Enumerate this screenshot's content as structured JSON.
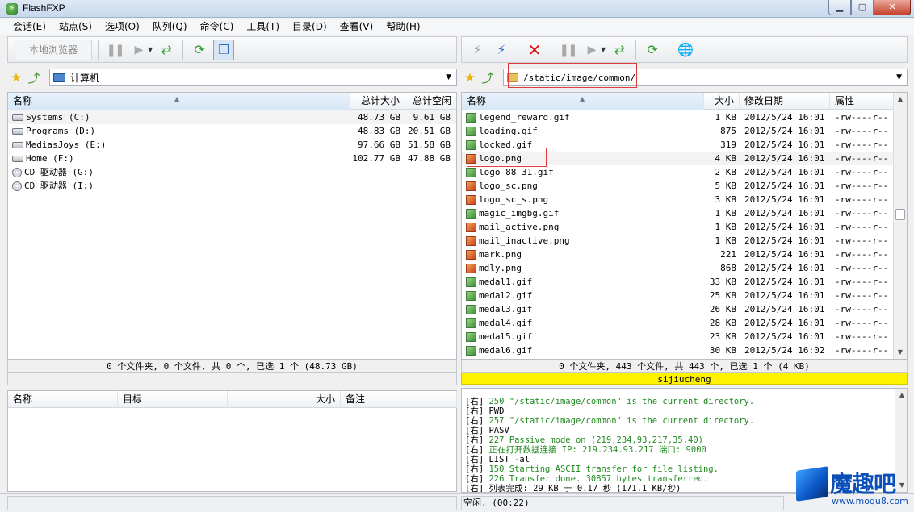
{
  "window": {
    "title": "FlashFXP",
    "icon": "flashfxp-app-icon"
  },
  "menu": [
    "会话(E)",
    "站点(S)",
    "选项(O)",
    "队列(Q)",
    "命令(C)",
    "工具(T)",
    "目录(D)",
    "查看(V)",
    "帮助(H)"
  ],
  "toolbar_left": {
    "browse_label": "本地浏览器"
  },
  "local": {
    "address": "计算机",
    "columns": {
      "name": "名称",
      "total": "总计大小",
      "free": "总计空闲"
    },
    "rows": [
      {
        "name": "Systems (C:)",
        "total": "48.73 GB",
        "free": "9.61 GB",
        "icon": "drive"
      },
      {
        "name": "Programs (D:)",
        "total": "48.83 GB",
        "free": "20.51 GB",
        "icon": "drive"
      },
      {
        "name": "MediasJoys (E:)",
        "total": "97.66 GB",
        "free": "51.58 GB",
        "icon": "drive"
      },
      {
        "name": "Home (F:)",
        "total": "102.77 GB",
        "free": "47.88 GB",
        "icon": "drive"
      },
      {
        "name": "CD 驱动器 (G:)",
        "total": "",
        "free": "",
        "icon": "cd"
      },
      {
        "name": "CD 驱动器 (I:)",
        "total": "",
        "free": "",
        "icon": "cd"
      }
    ],
    "status": "0 个文件夹, 0 个文件, 共 0 个, 已选 1 个 (48.73 GB)"
  },
  "remote": {
    "address": "/static/image/common/",
    "columns": {
      "name": "名称",
      "size": "大小",
      "date": "修改日期",
      "attr": "属性"
    },
    "rows": [
      {
        "name": "legend_reward.gif",
        "size": "1 KB",
        "date": "2012/5/24 16:01",
        "attr": "-rw----r--",
        "icon": "gif"
      },
      {
        "name": "loading.gif",
        "size": "875",
        "date": "2012/5/24 16:01",
        "attr": "-rw----r--",
        "icon": "gif"
      },
      {
        "name": "locked.gif",
        "size": "319",
        "date": "2012/5/24 16:01",
        "attr": "-rw----r--",
        "icon": "gif"
      },
      {
        "name": "logo.png",
        "size": "4 KB",
        "date": "2012/5/24 16:01",
        "attr": "-rw----r--",
        "icon": "png"
      },
      {
        "name": "logo_88_31.gif",
        "size": "2 KB",
        "date": "2012/5/24 16:01",
        "attr": "-rw----r--",
        "icon": "gif"
      },
      {
        "name": "logo_sc.png",
        "size": "5 KB",
        "date": "2012/5/24 16:01",
        "attr": "-rw----r--",
        "icon": "png"
      },
      {
        "name": "logo_sc_s.png",
        "size": "3 KB",
        "date": "2012/5/24 16:01",
        "attr": "-rw----r--",
        "icon": "png"
      },
      {
        "name": "magic_imgbg.gif",
        "size": "1 KB",
        "date": "2012/5/24 16:01",
        "attr": "-rw----r--",
        "icon": "gif"
      },
      {
        "name": "mail_active.png",
        "size": "1 KB",
        "date": "2012/5/24 16:01",
        "attr": "-rw----r--",
        "icon": "png"
      },
      {
        "name": "mail_inactive.png",
        "size": "1 KB",
        "date": "2012/5/24 16:01",
        "attr": "-rw----r--",
        "icon": "png"
      },
      {
        "name": "mark.png",
        "size": "221",
        "date": "2012/5/24 16:01",
        "attr": "-rw----r--",
        "icon": "png"
      },
      {
        "name": "mdly.png",
        "size": "868",
        "date": "2012/5/24 16:01",
        "attr": "-rw----r--",
        "icon": "png"
      },
      {
        "name": "medal1.gif",
        "size": "33 KB",
        "date": "2012/5/24 16:01",
        "attr": "-rw----r--",
        "icon": "gif"
      },
      {
        "name": "medal2.gif",
        "size": "25 KB",
        "date": "2012/5/24 16:01",
        "attr": "-rw----r--",
        "icon": "gif"
      },
      {
        "name": "medal3.gif",
        "size": "26 KB",
        "date": "2012/5/24 16:01",
        "attr": "-rw----r--",
        "icon": "gif"
      },
      {
        "name": "medal4.gif",
        "size": "28 KB",
        "date": "2012/5/24 16:01",
        "attr": "-rw----r--",
        "icon": "gif"
      },
      {
        "name": "medal5.gif",
        "size": "23 KB",
        "date": "2012/5/24 16:01",
        "attr": "-rw----r--",
        "icon": "gif"
      },
      {
        "name": "medal6.gif",
        "size": "30 KB",
        "date": "2012/5/24 16:02",
        "attr": "-rw----r--",
        "icon": "gif"
      }
    ],
    "status": "0 个文件夹, 443 个文件, 共 443 个, 已选 1 个 (4 KB)",
    "user": "sijiucheng"
  },
  "queue": {
    "columns": {
      "name": "名称",
      "target": "目标",
      "size": "大小",
      "note": "备注"
    }
  },
  "log": [
    {
      "tag": "[右]",
      "msg": "250 \"/static/image/common\" is the current directory.",
      "color": "green"
    },
    {
      "tag": "[右]",
      "msg": "PWD",
      "color": "black"
    },
    {
      "tag": "[右]",
      "msg": "257 \"/static/image/common\" is the current directory.",
      "color": "green"
    },
    {
      "tag": "[右]",
      "msg": "PASV",
      "color": "black"
    },
    {
      "tag": "[右]",
      "msg": "227 Passive mode on (219,234,93,217,35,40)",
      "color": "green"
    },
    {
      "tag": "[右]",
      "msg": "正在打开数据连接 IP: 219.234.93.217 端口: 9000",
      "color": "green"
    },
    {
      "tag": "[右]",
      "msg": "LIST -al",
      "color": "black"
    },
    {
      "tag": "[右]",
      "msg": "150 Starting ASCII transfer for file listing.",
      "color": "green"
    },
    {
      "tag": "[右]",
      "msg": "226 Transfer done. 30857 bytes transferred.",
      "color": "green"
    },
    {
      "tag": "[右]",
      "msg": "列表完成: 29 KB 于 0.17 秒 (171.1 KB/秒)",
      "color": "black"
    }
  ],
  "statusbar": {
    "right": "空闲. (00:22)"
  },
  "watermark": {
    "logo_text": "魔趣吧",
    "url": "www.moqu8.com"
  }
}
